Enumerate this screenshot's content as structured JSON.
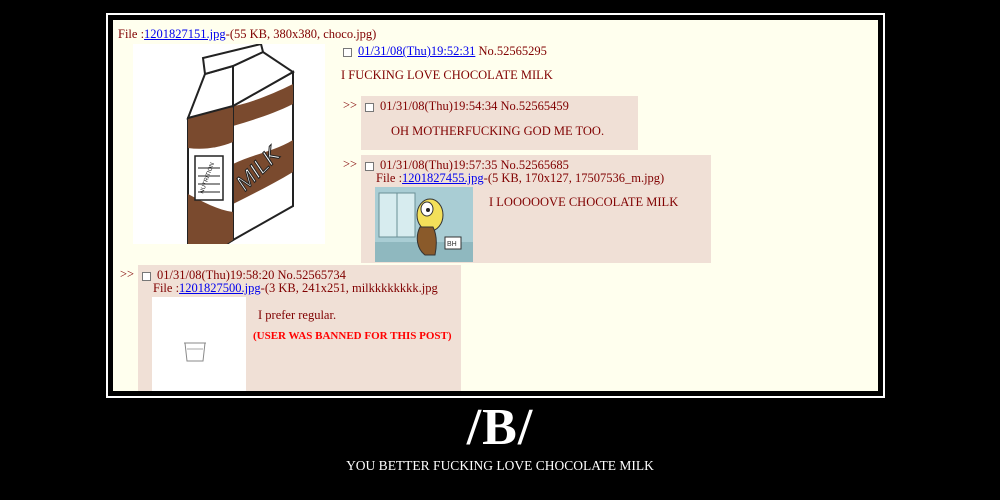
{
  "op": {
    "file_prefix": "File :",
    "file_link": "1201827151.jpg",
    "file_info": "-(55 KB, 380x380, choco.jpg)",
    "date_link": "01/31/08(Thu)19:52:31",
    "post_no": "No.52565295",
    "comment": "I FUCKING LOVE CHOCOLATE MILK",
    "image_label": "MILK",
    "image_sublabel": "NUTRITION"
  },
  "replies": [
    {
      "arrow": ">>",
      "header": "01/31/08(Thu)19:54:34 No.52565459",
      "comment": "OH MOTHERFUCKING GOD ME TOO."
    },
    {
      "arrow": ">>",
      "header": "01/31/08(Thu)19:57:35 No.52565685",
      "file_prefix": "File :",
      "file_link": "1201827455.jpg",
      "file_info": "-(5 KB, 170x127, 17507536_m.jpg)",
      "comment": "I LOOOOOVE CHOCOLATE MILK"
    },
    {
      "arrow": ">>",
      "header": "01/31/08(Thu)19:58:20 No.52565734",
      "file_prefix": "File :",
      "file_link": "1201827500.jpg",
      "file_info": "-(3 KB, 241x251, milkkkkkkkk.jpg",
      "comment": "I prefer regular.",
      "ban_notice": "(USER WAS BANNED FOR THIS POST)"
    }
  ],
  "poster": {
    "title": "/B/",
    "caption": "YOU BETTER FUCKING LOVE CHOCOLATE MILK"
  },
  "colors": {
    "background": "#000000",
    "board": "#FFFFEE",
    "reply": "#F0E0D6",
    "text": "#800000",
    "link": "#0000EE",
    "banned": "#FF0000"
  }
}
